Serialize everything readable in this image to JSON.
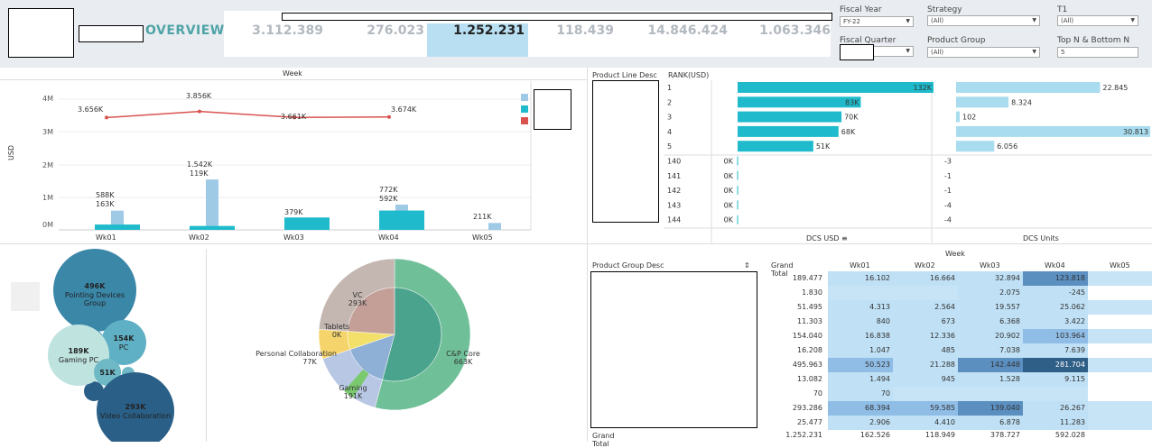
{
  "header": {
    "title": "OVERVIEW",
    "kpis": [
      "3.112.389",
      "276.023",
      "1.252.231",
      "118.439",
      "14.846.424",
      "1.063.346"
    ],
    "filters": {
      "fiscal_year_label": "Fiscal Year",
      "fiscal_year_value": "FY-22",
      "strategy_label": "Strategy",
      "strategy_value": "(All)",
      "t1_label": "T1",
      "t1_value": "(All)",
      "fiscal_quarter_label": "Fiscal Quarter",
      "product_group_label": "Product Group",
      "product_group_value": "(All)",
      "topn_label": "Top N & Bottom N",
      "topn_value": "5"
    }
  },
  "weekly_chart": {
    "title": "Week",
    "ylabel": "USD",
    "yticks": [
      "4M",
      "3M",
      "2M",
      "1M",
      "0M"
    ],
    "weeks": [
      "Wk01",
      "Wk02",
      "Wk03",
      "Wk04",
      "Wk05"
    ],
    "line_labels": [
      "3.656K",
      "3.856K",
      "3.661K",
      "3.674K"
    ],
    "bar_light_labels": [
      "588K",
      "1.542K",
      "",
      "772K",
      "211K"
    ],
    "bar_dark_labels": [
      "163K",
      "119K",
      "379K",
      "592K",
      ""
    ]
  },
  "chart_data": [
    {
      "type": "bar",
      "title": "Week",
      "ylabel": "USD",
      "ylim": [
        0,
        4400
      ],
      "categories": [
        "Wk01",
        "Wk02",
        "Wk03",
        "Wk04",
        "Wk05"
      ],
      "series": [
        {
          "values": [
            588,
            1542,
            0,
            772,
            211
          ],
          "color": "#9fcae6"
        },
        {
          "values": [
            163,
            119,
            379,
            592,
            0
          ],
          "color": "#1fbbcc"
        },
        {
          "values": [
            3656,
            3856,
            3661,
            3674,
            null
          ],
          "color": "#d9534f"
        }
      ]
    },
    {
      "type": "bar",
      "title": "DCS USD",
      "categories": [
        "1",
        "2",
        "3",
        "4",
        "5",
        "140",
        "141",
        "142",
        "143",
        "144"
      ],
      "values": [
        132,
        83,
        70,
        68,
        51,
        0,
        0,
        0,
        0,
        0
      ]
    },
    {
      "type": "bar",
      "title": "DCS Units",
      "categories": [
        "1",
        "2",
        "3",
        "4",
        "5",
        "140",
        "141",
        "142",
        "143",
        "144"
      ],
      "values": [
        22845,
        8324,
        102,
        30813,
        6056,
        -3,
        -1,
        -1,
        -4,
        -4
      ]
    },
    {
      "type": "pie",
      "labels": [
        "C&P Core",
        "Gaming",
        "Personal Collaboration",
        "Tablets",
        "VC"
      ],
      "values": [
        663,
        191,
        77,
        0,
        293
      ]
    }
  ],
  "rank_table": {
    "col1": "Product Line Desc",
    "col2": "RANK(USD)",
    "ranks": [
      "1",
      "2",
      "3",
      "4",
      "5",
      "140",
      "141",
      "142",
      "143",
      "144"
    ],
    "usd_labels": [
      "132K",
      "83K",
      "70K",
      "68K",
      "51K",
      "0K",
      "0K",
      "0K",
      "0K",
      "0K"
    ],
    "units_labels": [
      "22.845",
      "8.324",
      "102",
      "30.813",
      "6.056",
      "-3",
      "-1",
      "-1",
      "-4",
      "-4"
    ],
    "usd_title": "DCS USD",
    "units_title": "DCS Units"
  },
  "bubbles": [
    {
      "value": "496K",
      "label": "Pointing Devices Group"
    },
    {
      "value": "154K",
      "label": "PC"
    },
    {
      "value": "189K",
      "label": "Gaming PC"
    },
    {
      "value": "51K",
      "label": ""
    },
    {
      "value": "293K",
      "label": "Video Collaboration"
    }
  ],
  "pie": {
    "labels": [
      {
        "name": "VC",
        "value": "293K"
      },
      {
        "name": "Tablets",
        "value": "0K"
      },
      {
        "name": "Personal Collaboration",
        "value": "77K"
      },
      {
        "name": "Gaming",
        "value": "191K"
      },
      {
        "name": "C&P Core",
        "value": "663K"
      }
    ]
  },
  "heatmap": {
    "week_title": "Week",
    "row_header": "Product Group Desc",
    "cols": [
      "Grand Total",
      "Wk01",
      "Wk02",
      "Wk03",
      "Wk04",
      "Wk05"
    ],
    "rows": [
      [
        "189.477",
        "16.102",
        "16.664",
        "32.894",
        "123.818",
        ""
      ],
      [
        "1.830",
        "",
        "",
        "2.075",
        "-245",
        ""
      ],
      [
        "51.495",
        "4.313",
        "2.564",
        "19.557",
        "25.062",
        ""
      ],
      [
        "11.303",
        "840",
        "673",
        "6.368",
        "3.422",
        ""
      ],
      [
        "154.040",
        "16.838",
        "12.336",
        "20.902",
        "103.964",
        ""
      ],
      [
        "16.208",
        "1.047",
        "485",
        "7.038",
        "7.639",
        ""
      ],
      [
        "495.963",
        "50.523",
        "21.288",
        "142.448",
        "281.704",
        ""
      ],
      [
        "13.082",
        "1.494",
        "945",
        "1.528",
        "9.115",
        ""
      ],
      [
        "70",
        "70",
        "",
        "",
        "",
        ""
      ],
      [
        "293.286",
        "68.394",
        "59.585",
        "139.040",
        "26.267",
        ""
      ],
      [
        "25.477",
        "2.906",
        "4.410",
        "6.878",
        "11.283",
        ""
      ]
    ],
    "total_label": "Grand Total",
    "totals": [
      "1.252.231",
      "162.526",
      "118.949",
      "378.727",
      "592.028",
      ""
    ]
  }
}
